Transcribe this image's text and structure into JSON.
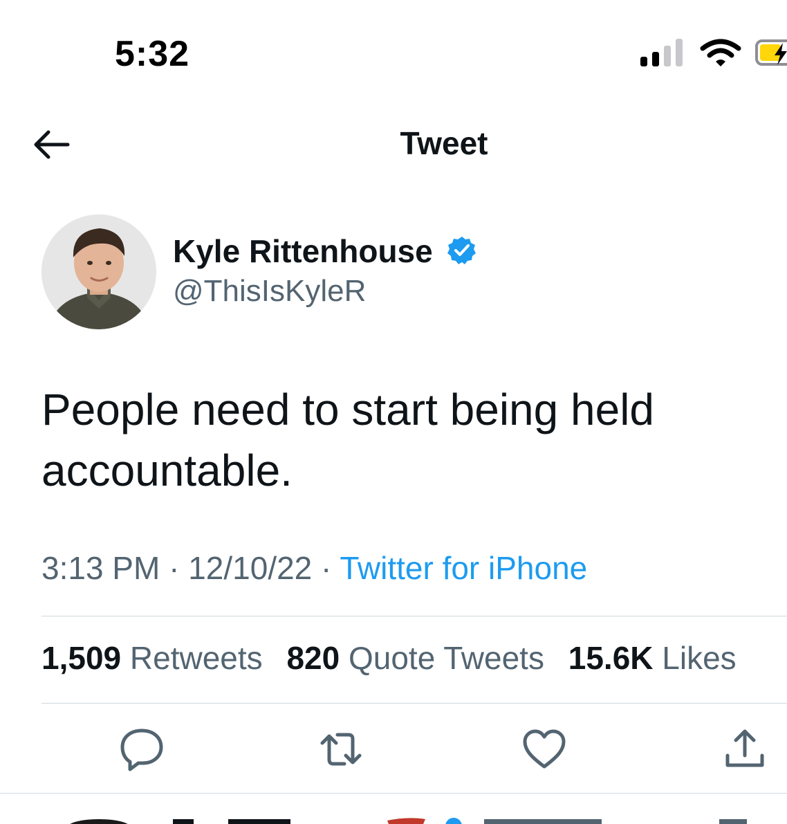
{
  "status_bar": {
    "time": "5:32"
  },
  "header": {
    "title": "Tweet"
  },
  "tweet": {
    "author_name": "Kyle Rittenhouse",
    "author_handle": "@ThisIsKyleR",
    "text": "People need to start being held accountable.",
    "time": "3:13 PM",
    "date": "12/10/22",
    "separator": "·",
    "source": "Twitter for iPhone",
    "stats": {
      "retweets_count": "1,509",
      "retweets_label": "Retweets",
      "quotes_count": "820",
      "quotes_label": "Quote Tweets",
      "likes_count": "15.6K",
      "likes_label": "Likes"
    }
  },
  "icons": {
    "back": "arrow-left-icon",
    "verified": "verified-badge-icon",
    "reply": "reply-icon",
    "retweet": "retweet-icon",
    "like": "heart-icon",
    "share": "share-icon"
  },
  "colors": {
    "text_primary": "#0f1419",
    "text_secondary": "#536471",
    "accent": "#1d9bf0",
    "divider": "#cfd9de"
  }
}
